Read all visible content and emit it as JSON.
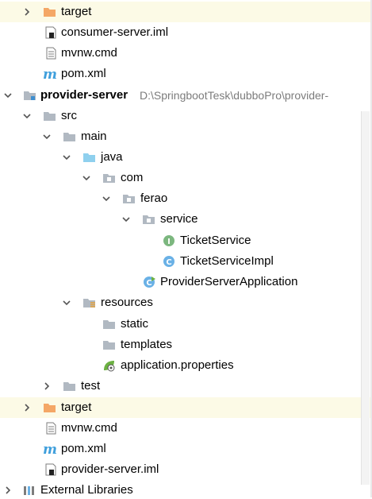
{
  "tree": {
    "items": [
      {
        "label": "target",
        "icon": "folder-orange-icon",
        "expanded": false,
        "highlighted": true
      },
      {
        "label": "consumer-server.iml",
        "icon": "iml-file-icon"
      },
      {
        "label": "mvnw.cmd",
        "icon": "text-file-icon"
      },
      {
        "label": "pom.xml",
        "icon": "maven-icon"
      },
      {
        "label": "provider-server",
        "icon": "module-folder-icon",
        "expanded": true,
        "bold": true,
        "path": "D:\\SpringbootTesk\\dubboPro\\provider-"
      },
      {
        "label": "src",
        "icon": "folder-icon",
        "expanded": true
      },
      {
        "label": "main",
        "icon": "folder-icon",
        "expanded": true
      },
      {
        "label": "java",
        "icon": "source-folder-icon",
        "expanded": true
      },
      {
        "label": "com",
        "icon": "package-icon",
        "expanded": true
      },
      {
        "label": "ferao",
        "icon": "package-icon",
        "expanded": true
      },
      {
        "label": "service",
        "icon": "package-icon",
        "expanded": true
      },
      {
        "label": "TicketService",
        "icon": "interface-icon"
      },
      {
        "label": "TicketServiceImpl",
        "icon": "class-icon"
      },
      {
        "label": "ProviderServerApplication",
        "icon": "spring-boot-class-icon"
      },
      {
        "label": "resources",
        "icon": "resources-folder-icon",
        "expanded": true
      },
      {
        "label": "static",
        "icon": "folder-icon"
      },
      {
        "label": "templates",
        "icon": "folder-icon"
      },
      {
        "label": "application.properties",
        "icon": "spring-properties-icon"
      },
      {
        "label": "test",
        "icon": "folder-icon",
        "expanded": false
      },
      {
        "label": "target",
        "icon": "folder-orange-icon",
        "expanded": false,
        "highlighted": true
      },
      {
        "label": "mvnw.cmd",
        "icon": "text-file-icon"
      },
      {
        "label": "pom.xml",
        "icon": "maven-icon"
      },
      {
        "label": "provider-server.iml",
        "icon": "iml-file-icon"
      },
      {
        "label": "External Libraries",
        "icon": "libraries-icon",
        "expanded": false
      }
    ]
  },
  "colors": {
    "highlight_row": "#fcfae6",
    "folder": "#b1b9c2",
    "folder_orange": "#f4a766",
    "source_folder": "#8fd0ee",
    "interface_green": "#7cb77f",
    "class_blue": "#6ab1e6",
    "spring_green": "#6cb142",
    "maven_blue": "#3f9fdc",
    "path_gray": "#7c7c7c"
  }
}
